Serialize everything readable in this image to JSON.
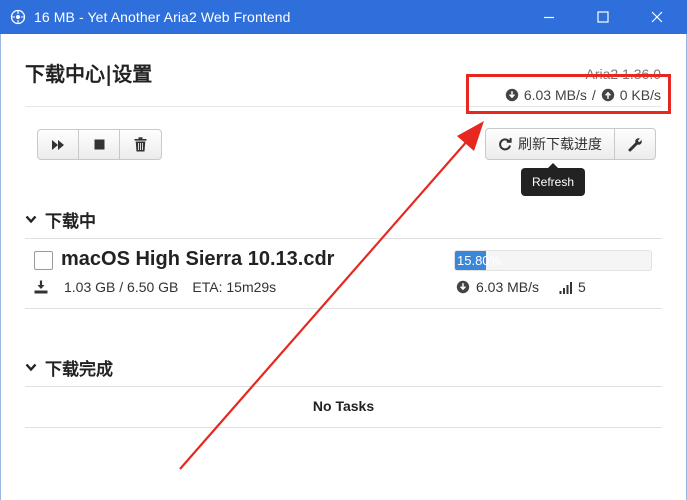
{
  "window": {
    "title": "16 MB - Yet Another Aria2 Web Frontend",
    "icon": "aria2-logo-icon",
    "controls": {
      "minimize": "minimize-icon",
      "maximize": "maximize-icon",
      "close": "close-icon"
    }
  },
  "header": {
    "title": "下载中心|设置",
    "version": "Aria2 1.36.0",
    "download_speed": "6.03 MB/s",
    "separator": "/",
    "upload_speed": "0 KB/s"
  },
  "toolbar": {
    "buttons": [
      {
        "name": "start-all",
        "icon": "fast-forward-icon"
      },
      {
        "name": "stop-all",
        "icon": "stop-icon"
      },
      {
        "name": "remove",
        "icon": "trash-icon"
      }
    ],
    "refresh_label": "刷新下载进度",
    "refresh_icon": "refresh-icon",
    "settings_icon": "wrench-icon",
    "tooltip": "Refresh"
  },
  "downloading": {
    "heading": "下载中",
    "tasks": [
      {
        "name": "macOS High Sierra 10.13.cdr",
        "size": "1.03 GB / 6.50 GB",
        "eta": "ETA: 15m29s",
        "progress_label": "15.80%",
        "progress": 15.8,
        "speed": "6.03 MB/s",
        "connections": "5"
      }
    ]
  },
  "completed": {
    "heading": "下载完成",
    "empty_message": "No Tasks"
  },
  "colors": {
    "titlebar": "#2e6fdc",
    "progress": "#3a87d8",
    "annotation": "#e62820"
  }
}
